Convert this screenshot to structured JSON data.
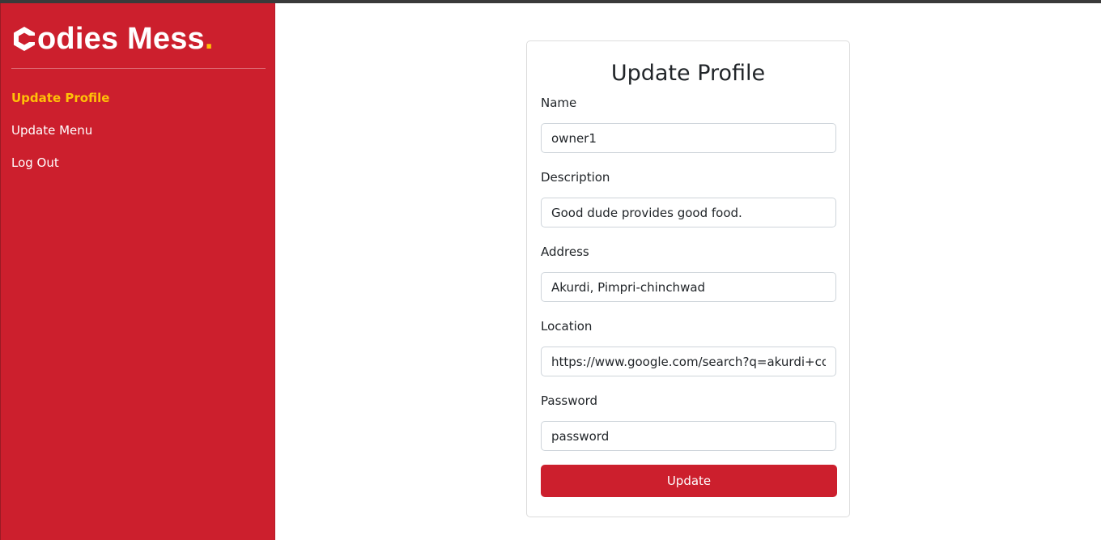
{
  "sidebar": {
    "brand": {
      "text": "odies Mess",
      "dot": ".",
      "icon": "codies-hexagon-logo-icon"
    },
    "items": [
      {
        "label": "Update Profile",
        "active": true
      },
      {
        "label": "Update Menu",
        "active": false
      },
      {
        "label": "Log Out",
        "active": false
      }
    ]
  },
  "form": {
    "title": "Update Profile",
    "fields": [
      {
        "label": "Name",
        "value": "owner1"
      },
      {
        "label": "Description",
        "value": "Good dude provides good food."
      },
      {
        "label": "Address",
        "value": "Akurdi, Pimpri-chinchwad"
      },
      {
        "label": "Location",
        "value": "https://www.google.com/search?q=akurdi+coordinates"
      },
      {
        "label": "Password",
        "value": "password"
      }
    ],
    "submit_label": "Update"
  },
  "colors": {
    "sidebar_bg": "#cc1f2d",
    "accent": "#ffc107",
    "button_bg": "#cc1f2d"
  }
}
